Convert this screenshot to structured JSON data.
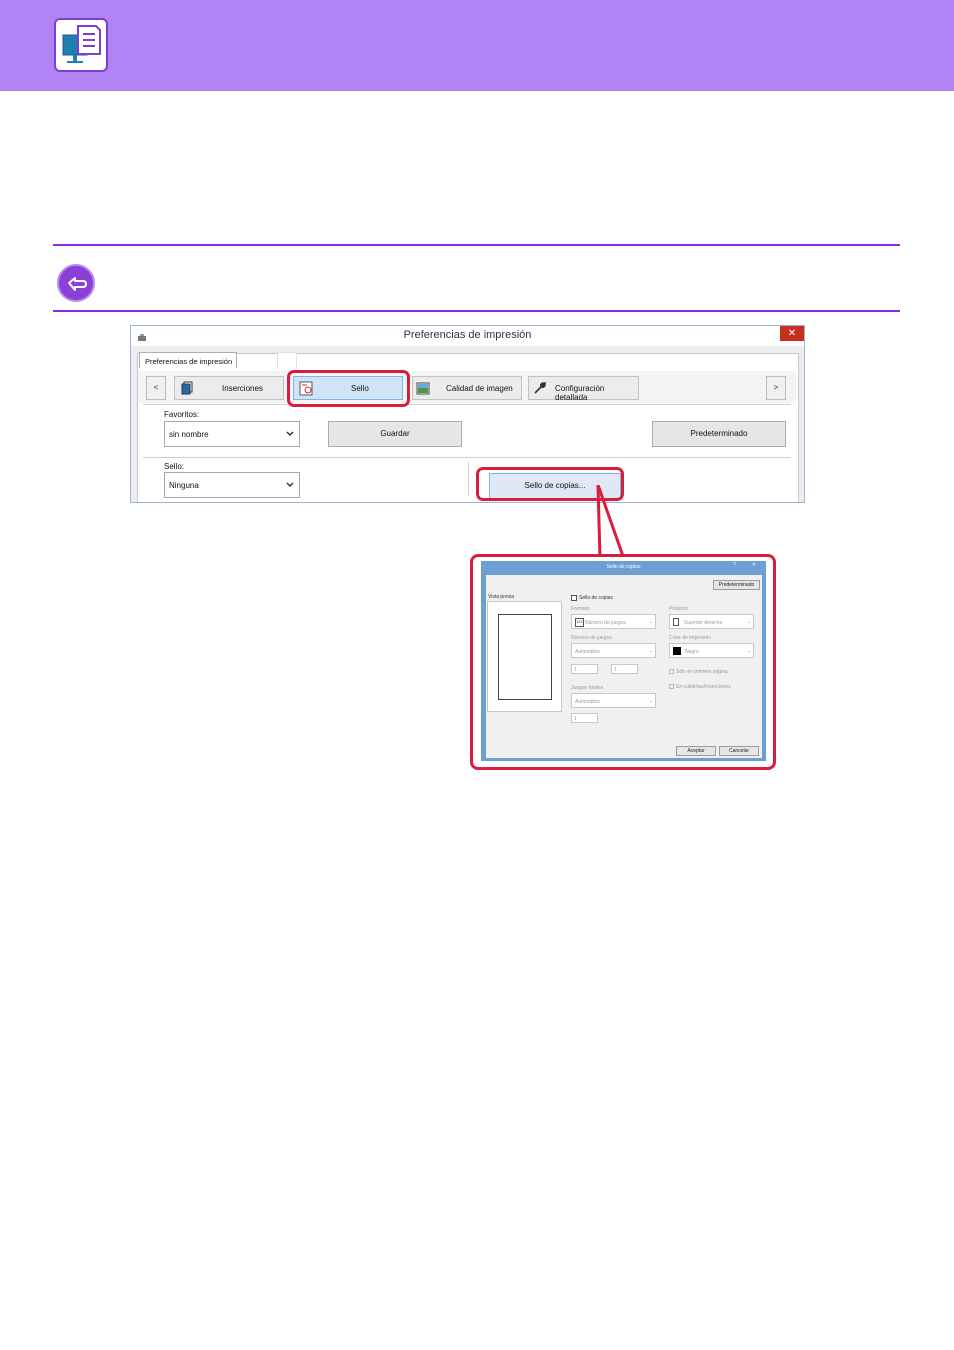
{
  "header": {
    "icon": "monitor-document-icon"
  },
  "note": {
    "icon": "return-arrow-icon"
  },
  "main_dialog": {
    "title": "Preferencias de impresión",
    "close_glyph": "✕",
    "tab_label": "Preferencias de impresión",
    "nav_prev": "<",
    "nav_next": ">",
    "toolbar": [
      {
        "label": "Inserciones",
        "icon": "copies-stack-icon"
      },
      {
        "label": "Sello",
        "icon": "stamp-icon"
      },
      {
        "label": "Calidad de imagen",
        "icon": "image-quality-icon"
      },
      {
        "label": "Configuración detallada",
        "icon": "wrench-icon"
      }
    ],
    "favorites_label": "Favoritos:",
    "favorites_value": "sin nombre",
    "save_button": "Guardar",
    "default_button": "Predeterminado",
    "stamp_label": "Sello:",
    "stamp_value": "Ninguna",
    "copy_stamp_button": "Sello de copias..."
  },
  "inset_dialog": {
    "title": "Sello de copias",
    "help_glyph": "?",
    "close_glyph": "✕",
    "default_button": "Predeterminado",
    "preview_label": "Vista previa",
    "copy_stamp_checkbox": "Sello de copias",
    "format_label": "Formato",
    "format_value": "Número de juegos",
    "format_icon_text": "123",
    "position_label": "Posición",
    "position_value": "Superior derecho",
    "set_number_label": "Número de juegos",
    "set_number_value": "Automático",
    "print_color_label": "Color de impresión",
    "print_color_value": "Negro",
    "field_a": "1",
    "field_b": "1",
    "first_page_only": "Sólo en primera página",
    "on_inserted_covers": "En cubiertas/Inserciones",
    "total_sets_label": "Juegos totales",
    "total_sets_value": "Automático",
    "field_c": "1",
    "ok_button": "Aceptar",
    "cancel_button": "Cancelar"
  }
}
